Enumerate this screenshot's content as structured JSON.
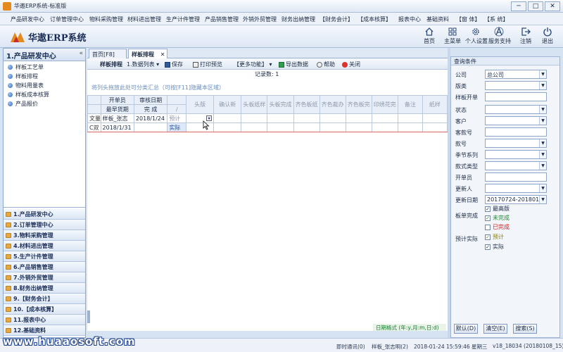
{
  "window": {
    "title": "华遨ERP系统-标准版",
    "min": "─",
    "max": "□",
    "close": "✕"
  },
  "menu": [
    "产品研发中心",
    "订单管理中心",
    "物料采购管理",
    "材料进出管理",
    "生产计件管理",
    "产品销售管理",
    "外销外贸管理",
    "财务出纳管理",
    "【财务会计】",
    "【成本核算】",
    "报表中心",
    "基础资料",
    "【窗 体】",
    "【系 统】"
  ],
  "header": {
    "brand": "华遨ERP系统",
    "buttons": [
      {
        "label": "首页",
        "icon": "home-icon"
      },
      {
        "label": "主菜单",
        "icon": "grid-menu-icon"
      },
      {
        "label": "个人设置",
        "icon": "gear-icon"
      },
      {
        "label": "服务支持",
        "icon": "support-icon"
      },
      {
        "label": "注销",
        "icon": "logout-icon"
      },
      {
        "label": "退出",
        "icon": "power-icon"
      }
    ]
  },
  "left_panel": {
    "title": "1.产品研发中心",
    "collapse": "«",
    "tree": [
      "样板工艺单",
      "样板排程",
      "物料用量表",
      "样板成本核算",
      "产品报价"
    ],
    "modules": [
      "1.产品研发中心",
      "2.订单管理中心",
      "3.物料采购管理",
      "4.材料进出管理",
      "5.生产计件管理",
      "6.产品销售管理",
      "7.外销外贸管理",
      "8.财务出纳管理",
      "9.【财务会计】",
      "10.【成本核算】",
      "11.报表中心",
      "12.基础资料"
    ]
  },
  "tabs": [
    {
      "label": "首页[F8]"
    },
    {
      "label": "样板排程"
    }
  ],
  "tab_close": "✕",
  "toolbar": {
    "title": "样板排程",
    "list": "1.数据列表 ▾",
    "save": "保存",
    "print": "打印预览",
    "more": "【更多功能】 ▾",
    "export": "导出数据",
    "help": "帮助",
    "close": "关闭"
  },
  "record_count": "记录数: 1",
  "hint": "将列头拖放此处可分类汇总（可按[F11]隐藏本区域）",
  "grid": {
    "header1": [
      "",
      "开单员",
      "审核日期",
      "",
      "头版",
      "确认新",
      "头板纸样",
      "头板完成",
      "齐色板纸",
      "齐色裁办",
      "齐色板完",
      "印绣花完",
      "备注",
      "纸样"
    ],
    "header2": [
      "",
      "最早货期",
      "完 成",
      "/"
    ],
    "row1": [
      "文量",
      "样板_张志",
      "2018/1/24",
      "预计",
      "",
      "",
      "",
      "",
      "",
      "",
      "",
      "",
      "",
      ""
    ],
    "row2": [
      "C双",
      "2018/1/31",
      "",
      "实际",
      "",
      "",
      "",
      "",
      "",
      "",
      "",
      "",
      "",
      ""
    ]
  },
  "date_format": "日期格式 (年:y,月:m,日:d)",
  "filter": {
    "title": "查询条件",
    "fields": [
      {
        "label": "公司",
        "value": "总公司",
        "dropdown": true
      },
      {
        "label": "版类",
        "value": "",
        "dropdown": true
      },
      {
        "label": "样板开单",
        "value": "",
        "dropdown": false
      },
      {
        "label": "状态",
        "value": "",
        "dropdown": true
      },
      {
        "label": "客户",
        "value": "",
        "dropdown": true
      },
      {
        "label": "客款号",
        "value": "",
        "dropdown": false
      },
      {
        "label": "款号",
        "value": "",
        "dropdown": true
      },
      {
        "label": "季节系列",
        "value": "",
        "dropdown": true
      },
      {
        "label": "款式类型",
        "value": "",
        "dropdown": true
      },
      {
        "label": "开单员",
        "value": "",
        "dropdown": false
      },
      {
        "label": "更新人",
        "value": "",
        "dropdown": true
      },
      {
        "label": "更新日期",
        "value": "20170724-20180124",
        "dropdown": true
      }
    ],
    "checks_label_1": "板单完成",
    "checks_label_2": "预计实际",
    "checks": [
      {
        "label": "最高版",
        "checked": "✓"
      },
      {
        "label": "未完成",
        "checked": "✓"
      },
      {
        "label": "已完成",
        "checked": ""
      },
      {
        "label": "预计",
        "checked": "✓"
      },
      {
        "label": "实际",
        "checked": "✓"
      }
    ],
    "buttons": [
      "默认(D)",
      "清空(E)",
      "搜索(S)"
    ]
  },
  "footer": {
    "watermark": "www.huaaosoft.com",
    "im": "即时通讯(0)",
    "user": "样板_张志明(2)",
    "datetime": "2018-01-24  15:59:46  星期三",
    "version": "v18_18034 (20180108_15)"
  },
  "colors": {
    "accent": "#2f6cc2",
    "header_bg": "#dde7f4",
    "red": "#c22"
  }
}
